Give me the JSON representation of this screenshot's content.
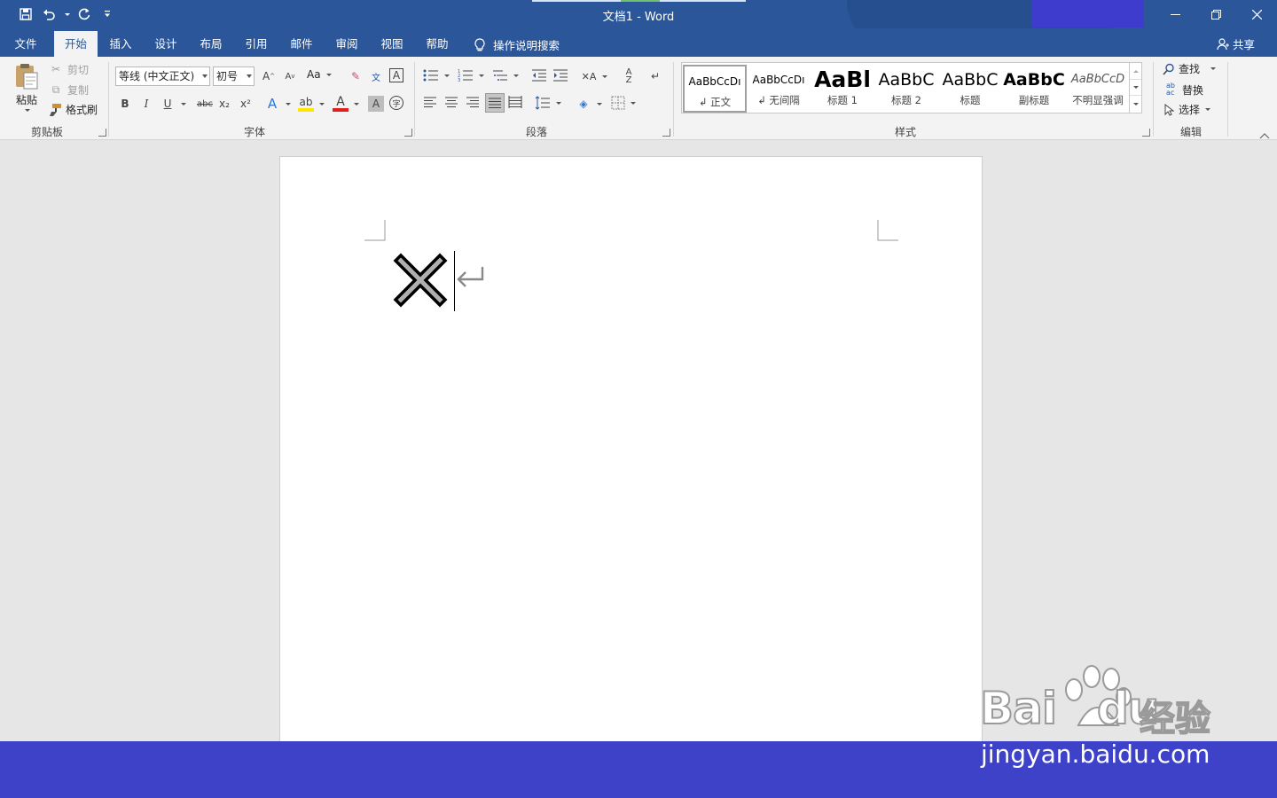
{
  "window": {
    "title": "文档1  -  Word",
    "controls": [
      "minimize-icon",
      "restore-icon",
      "close-icon"
    ]
  },
  "quick_access": [
    "save-icon",
    "undo-icon",
    "redo-icon",
    "customize-icon"
  ],
  "tabs": [
    {
      "label": "文件"
    },
    {
      "label": "开始",
      "active": true
    },
    {
      "label": "插入"
    },
    {
      "label": "设计"
    },
    {
      "label": "布局"
    },
    {
      "label": "引用"
    },
    {
      "label": "邮件"
    },
    {
      "label": "审阅"
    },
    {
      "label": "视图"
    },
    {
      "label": "帮助"
    }
  ],
  "tell_me": "操作说明搜索",
  "share": "共享",
  "clipboard": {
    "group": "剪贴板",
    "paste": "粘贴",
    "cut": "剪切",
    "copy": "复制",
    "format_painter": "格式刷"
  },
  "font": {
    "group": "字体",
    "font_name": "等线 (中文正文)",
    "font_size": "初号",
    "case_label": "Aa",
    "bold": "B",
    "italic": "I",
    "underline": "U",
    "strike": "abc",
    "subscript": "x₂",
    "superscript": "x²",
    "color_letter": "A"
  },
  "paragraph": {
    "group": "段落"
  },
  "styles": {
    "group": "样式",
    "items": [
      {
        "sample": "AaBbCcDı",
        "name": "↲ 正文"
      },
      {
        "sample": "AaBbCcDı",
        "name": "↲ 无间隔"
      },
      {
        "sample": "AaBl",
        "name": "标题 1"
      },
      {
        "sample": "AaBbC",
        "name": "标题 2"
      },
      {
        "sample": "AaBbC",
        "name": "标题"
      },
      {
        "sample": "AaBbC",
        "name": "副标题"
      },
      {
        "sample": "AaBbCcD",
        "name": "不明显强调"
      }
    ]
  },
  "editing": {
    "group": "编辑",
    "find": "查找",
    "replace": "替换",
    "select": "选择"
  },
  "document": {
    "content_symbol": "heavy-x-symbol",
    "colors": {
      "page": "#ffffff",
      "canvas": "#e6e6e6",
      "symbol_fill": "#b0b0b0"
    }
  },
  "watermark": {
    "brand": "Bai",
    "brand2": "du",
    "cn": "经验",
    "url": "jingyan.baidu.com"
  },
  "colors": {
    "title_bar": "#2b579a",
    "ribbon": "#f3f3f3",
    "bottom_bar": "#3e42c8"
  }
}
